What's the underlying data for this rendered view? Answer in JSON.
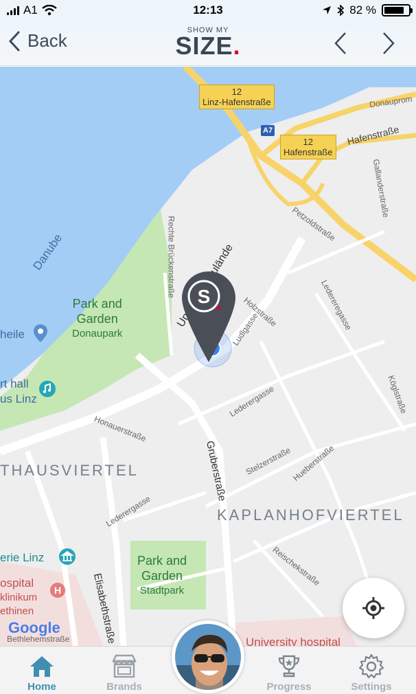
{
  "status_bar": {
    "carrier": "A1",
    "time": "12:13",
    "battery_percent": "82 %",
    "battery_level": 0.82
  },
  "nav": {
    "back_label": "Back",
    "logo_small": "SHOW MY",
    "logo_big": "SIZE",
    "logo_dot": "."
  },
  "map": {
    "river_label": "Danube",
    "road_signs": [
      {
        "number": "12",
        "name": "Linz-Hafenstraße"
      },
      {
        "number": "12",
        "name": "Hafenstraße"
      }
    ],
    "highway_badge": "A7",
    "parks": [
      {
        "name": "Park and",
        "name2": "Garden",
        "sub": "Donaupark"
      },
      {
        "name": "Park and",
        "name2": "Garden",
        "sub": "Stadtpark"
      }
    ],
    "districts": [
      "THAUSVIERTEL",
      "KAPLANHOFVIERTEL"
    ],
    "streets": {
      "donaupro": "Donauprom",
      "hafenstrasse": "Hafenstraße",
      "petzold": "Petzoldstraße",
      "gallander": "Gallanderstraße",
      "rechte": "Rechte Brückenstraße",
      "untere": "Untere Donaulände",
      "holz": "Holzstraße",
      "ludl": "Ludlgasse",
      "lederer_right": "Ledereregasse",
      "lederer_mid": "Lederergasse",
      "lederer_left": "Lederergasse",
      "koeglstrasse": "Köglstraße",
      "honauer": "Honauerstraße",
      "gruber": "Gruberstraße",
      "stelzer": "Stelzerstraße",
      "hueber": "Hueberstraße",
      "reischek": "Reischekstraße",
      "elisabeth": "Elisabethstraße",
      "bethlehem": "Bethlehemstraße"
    },
    "pois": {
      "heile": "heile",
      "hall_1": "rt hall",
      "hall_2": "us Linz",
      "galerie": "erie Linz",
      "hospital_1": "ospital",
      "hospital_2": "klinikum",
      "hospital_3": "ethinen",
      "university": "University hospital"
    },
    "attribution": "Google",
    "marker_letter": "S",
    "colors": {
      "water": "#a3cdf5",
      "park": "#c5e7b4",
      "highway": "#f7d36a",
      "marker": "#4a4f57",
      "location": "#3b82f0"
    }
  },
  "tabs": [
    {
      "label": "Home",
      "icon": "home-icon",
      "active": true
    },
    {
      "label": "Brands",
      "icon": "store-icon",
      "active": false
    },
    {
      "label": "Progress",
      "icon": "trophy-icon",
      "active": false
    },
    {
      "label": "Settings",
      "icon": "gear-icon",
      "active": false
    }
  ],
  "accent_color": "#3f8fb0"
}
